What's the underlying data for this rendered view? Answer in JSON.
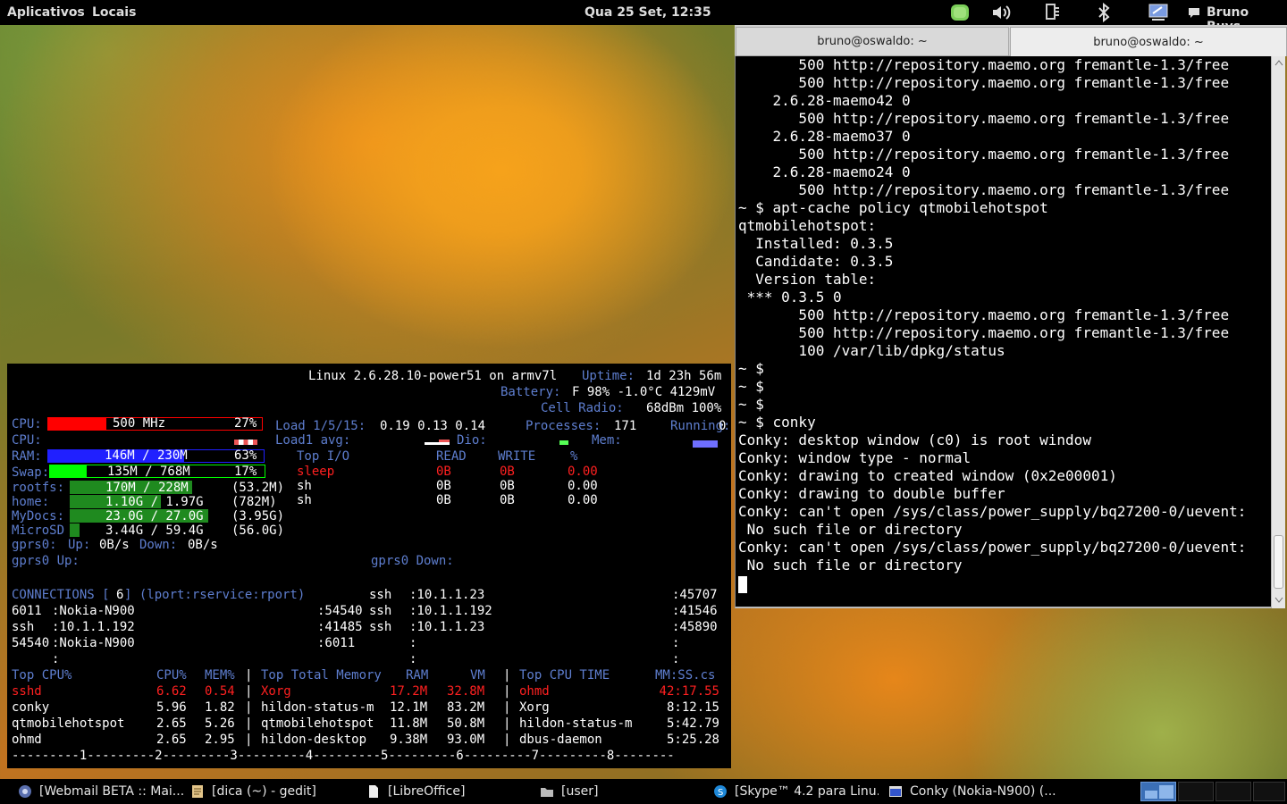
{
  "panel": {
    "menu_apps": "Aplicativos",
    "menu_places": "Locais",
    "clock": "Qua 25 Set, 12:35",
    "user": "Bruno Buys"
  },
  "conky": {
    "header": {
      "system": "Linux 2.6.28.10-power51 on armv7l",
      "uptime_label": "Uptime:",
      "uptime_value": "1d 23h 56m",
      "battery_label": "Battery:",
      "battery_value": "F 98% -1.0°C 4129mV",
      "cell_label": "Cell Radio:",
      "cell_value": "68dBm 100%"
    },
    "cpu": {
      "label": "CPU:",
      "freq": "500 MHz",
      "pct": "27%",
      "level": 0.27,
      "label2": "CPU:"
    },
    "load": {
      "label": "Load 1/5/15:",
      "values": "0.19 0.13 0.14",
      "processes_label": "Processes:",
      "processes": "171",
      "running_label": "Running:",
      "running": "0",
      "avg_label": "Load1 avg:",
      "dio_label": "Dio:",
      "mem_label": "Mem:"
    },
    "ram": {
      "label": "RAM:",
      "value": "146M / 230M",
      "pct": "63%",
      "level": 0.63
    },
    "swap": {
      "label": "Swap:",
      "value": "135M / 768M",
      "pct": "17%",
      "level": 0.17
    },
    "fs": [
      {
        "label": "rootfs:",
        "value": "170M / 228M",
        "free": "(53.2M)",
        "level": 0.75
      },
      {
        "label": "home:",
        "value": "1.10G / 1.97G",
        "free": "(782M)",
        "level": 0.56
      },
      {
        "label": "MyDocs:",
        "value": "23.0G / 27.0G",
        "free": "(3.95G)",
        "level": 0.85
      },
      {
        "label": "MicroSD",
        "value": "3.44G / 59.4G",
        "free": "(56.0G)",
        "level": 0.06
      }
    ],
    "io": {
      "title": "Top I/O",
      "cols": [
        "READ",
        "WRITE",
        "%"
      ],
      "rows": [
        [
          "sleep",
          "0B",
          "0B",
          "0.00"
        ],
        [
          "sh",
          "0B",
          "0B",
          "0.00"
        ],
        [
          "sh",
          "0B",
          "0B",
          "0.00"
        ]
      ]
    },
    "net": {
      "line1": "gprs0: Up: 0B/s Down: 0B/s",
      "gprs_up_prefix": "gprs0:",
      "up_label": "Up:",
      "up_value": "0B/s",
      "down_label": "Down:",
      "down_value": "0B/s",
      "graph_up": "gprs0 Up:",
      "graph_down": "gprs0 Down:"
    },
    "connections": {
      "title_pre": "CONNECTIONS [",
      "count": "6",
      "title_post": "] (lport:rservice:rport)",
      "rows": [
        [
          "ssh",
          ":10.1.1.23",
          ":45707"
        ],
        [
          "6011",
          ":Nokia-N900",
          ":54540",
          "ssh",
          ":10.1.1.192",
          ":41546"
        ],
        [
          "ssh",
          ":10.1.1.192",
          ":41485",
          "ssh",
          ":10.1.1.23",
          ":45890"
        ],
        [
          "54540",
          ":Nokia-N900",
          ":6011",
          ":",
          ":"
        ],
        [
          ":",
          ":",
          ":"
        ]
      ]
    },
    "procs": {
      "cpu_title": "Top CPU%",
      "cpu_col1": "CPU%",
      "cpu_col2": "MEM%",
      "mem_title": "Top Total Memory",
      "mem_col1": "RAM",
      "mem_col2": "VM",
      "time_title": "Top CPU TIME",
      "time_col": "MM:SS.cs",
      "sep": "|",
      "cpu_rows": [
        [
          "sshd",
          "6.62",
          "0.54"
        ],
        [
          "conky",
          "5.96",
          "1.82"
        ],
        [
          "qtmobilehotspot",
          "2.65",
          "5.26"
        ],
        [
          "ohmd",
          "2.65",
          "2.95"
        ]
      ],
      "mem_rows": [
        [
          "Xorg",
          "17.2M",
          "32.8M"
        ],
        [
          "hildon-status-m",
          "12.1M",
          "83.2M"
        ],
        [
          "qtmobilehotspot",
          "11.8M",
          "50.8M"
        ],
        [
          "hildon-desktop",
          "9.38M",
          "93.0M"
        ]
      ],
      "time_rows": [
        [
          "ohmd",
          "42:17.55"
        ],
        [
          "Xorg",
          "8:12.15"
        ],
        [
          "hildon-status-m",
          "5:42.79"
        ],
        [
          "dbus-daemon",
          "5:25.28"
        ]
      ],
      "ruler": "---------1---------2---------3---------4---------5---------6---------7---------8--------"
    }
  },
  "terminal": {
    "tabs": [
      "bruno@oswaldo: ~",
      "bruno@oswaldo: ~"
    ],
    "lines": [
      "       500 http://repository.maemo.org fremantle-1.3/free",
      "       500 http://repository.maemo.org fremantle-1.3/free",
      "    2.6.28-maemo42 0",
      "       500 http://repository.maemo.org fremantle-1.3/free",
      "    2.6.28-maemo37 0",
      "       500 http://repository.maemo.org fremantle-1.3/free",
      "    2.6.28-maemo24 0",
      "       500 http://repository.maemo.org fremantle-1.3/free",
      "~ $ apt-cache policy qtmobilehotspot",
      "qtmobilehotspot:",
      "  Installed: 0.3.5",
      "  Candidate: 0.3.5",
      "  Version table:",
      " *** 0.3.5 0",
      "       500 http://repository.maemo.org fremantle-1.3/free",
      "       500 http://repository.maemo.org fremantle-1.3/free",
      "       100 /var/lib/dpkg/status",
      "~ $",
      "~ $",
      "~ $",
      "~ $ conky",
      "Conky: desktop window (c0) is root window",
      "Conky: window type - normal",
      "Conky: drawing to created window (0x2e00001)",
      "Conky: drawing to double buffer",
      "Conky: can't open /sys/class/power_supply/bq27200-0/uevent:",
      " No such file or directory",
      "Conky: can't open /sys/class/power_supply/bq27200-0/uevent:",
      " No such file or directory"
    ]
  },
  "taskbar": {
    "items": [
      {
        "label": "[Webmail BETA :: Mai...",
        "icon": "browser-icon"
      },
      {
        "label": "[dica (~) - gedit]",
        "icon": "text-editor-icon"
      },
      {
        "label": "[LibreOffice]",
        "icon": "document-icon"
      },
      {
        "label": "[user]",
        "icon": "folder-icon"
      },
      {
        "label": "[Skype™ 4.2 para Linu...",
        "icon": "skype-icon"
      },
      {
        "label": "Conky (Nokia-N900) (...",
        "icon": "window-icon"
      }
    ]
  },
  "colors": {
    "cpu_bar": "#ff0000",
    "ram_bar": "#2020ff",
    "swap_bar": "#00ff00",
    "fs_bar": "#1f8a1f",
    "label_blue": "#5e7ecf",
    "alert_red": "#ff2020"
  }
}
